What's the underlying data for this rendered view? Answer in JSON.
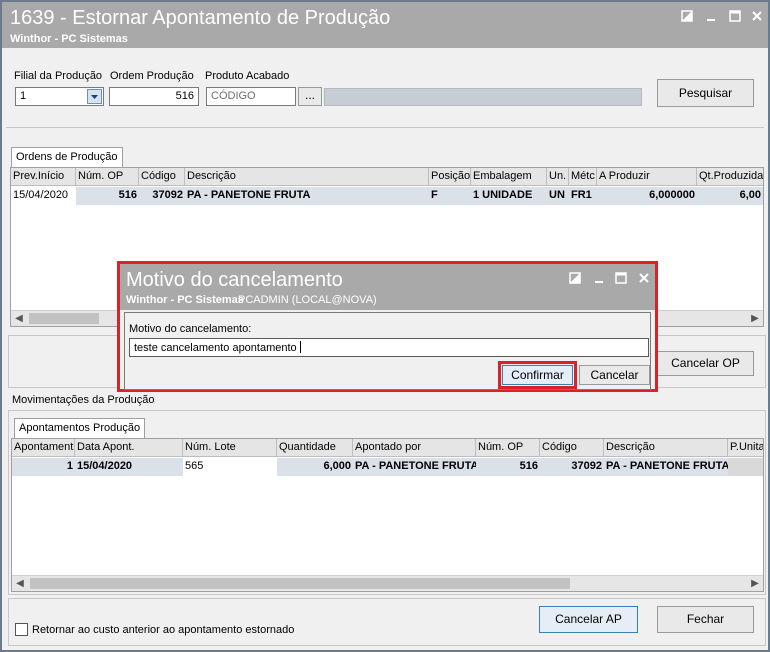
{
  "window": {
    "title": "1639 - Estornar Apontamento de Produção",
    "subtitle": "Winthor - PC Sistemas"
  },
  "filters": {
    "filial_label": "Filial da Produção",
    "filial_value": "1",
    "ordem_label": "Ordem Produção",
    "ordem_value": "516",
    "produto_label": "Produto Acabado",
    "produto_placeholder": "CÓDIGO",
    "produto_lookup_button": "...",
    "produto_description": "",
    "pesquisar_button": "Pesquisar"
  },
  "ordens": {
    "tab_label": "Ordens de Produção",
    "columns": [
      "Prev.Início",
      "Núm. OP",
      "Código",
      "Descrição",
      "Posição",
      "Embalagem",
      "Un.",
      "Métc",
      "A Produzir",
      "Qt.Produzida"
    ],
    "rows": [
      [
        "15/04/2020",
        "516",
        "37092",
        "PA - PANETONE FRUTA",
        "F",
        "1 UNIDADE",
        "UN",
        "FR1",
        "6,000000",
        "6,00"
      ]
    ],
    "cancelar_op_button": "Cancelar OP"
  },
  "movimentacoes": {
    "section_label": "Movimentações da Produção",
    "tab_label": "Apontamentos Produção",
    "columns": [
      "Apontament",
      "Data Apont.",
      "Núm. Lote",
      "Quantidade",
      "Apontado por",
      "Núm. OP",
      "Código",
      "Descrição",
      "P.Unita"
    ],
    "rows": [
      [
        "1",
        "15/04/2020",
        "565",
        "6,000",
        "PA - PANETONE FRUTA",
        "516",
        "37092",
        "PA - PANETONE FRUTA",
        ""
      ]
    ]
  },
  "footer": {
    "checkbox_label": "Retornar ao custo anterior ao apontamento estornado",
    "checkbox_checked": false,
    "cancelar_ap_button": "Cancelar AP",
    "fechar_button": "Fechar"
  },
  "dialog": {
    "title": "Motivo do cancelamento",
    "subtitle": "Winthor - PC Sistemas",
    "user_info": "PCADMIN (LOCAL@NOVA)",
    "field_label": "Motivo do cancelamento:",
    "field_value": "teste cancelamento apontamento",
    "confirmar_button": "Confirmar",
    "cancelar_button": "Cancelar"
  },
  "colors": {
    "titlebar": "#a9a9a9",
    "highlight": "#d9232a",
    "row_selected": "#dbe1e8"
  }
}
